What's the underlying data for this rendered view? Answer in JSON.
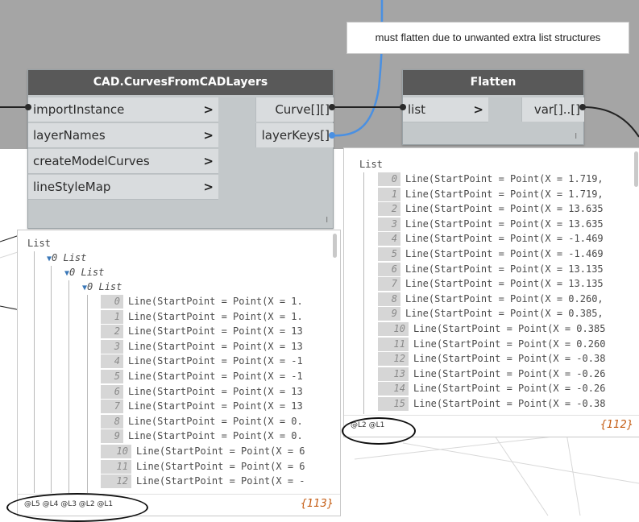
{
  "note": {
    "text": "must flatten due to unwanted extra list structures"
  },
  "node_cad": {
    "title": "CAD.CurvesFromCADLayers",
    "inputs": [
      "importInstance",
      "layerNames",
      "createModelCurves",
      "lineStyleMap"
    ],
    "outputs": [
      "Curve[][]",
      "layerKeys[]"
    ],
    "arrow": ">",
    "lacing_mark": "l"
  },
  "node_flatten": {
    "title": "Flatten",
    "inputs": [
      "list"
    ],
    "outputs": [
      "var[]..[]"
    ],
    "arrow": ">",
    "lacing_mark": "l"
  },
  "preview_left": {
    "root": "List",
    "nested": [
      "0 List",
      "0 List",
      "0 List"
    ],
    "items": [
      {
        "i": "0",
        "t": "Line(StartPoint = Point(X = 1."
      },
      {
        "i": "1",
        "t": "Line(StartPoint = Point(X = 1."
      },
      {
        "i": "2",
        "t": "Line(StartPoint = Point(X = 13"
      },
      {
        "i": "3",
        "t": "Line(StartPoint = Point(X = 13"
      },
      {
        "i": "4",
        "t": "Line(StartPoint = Point(X = -1"
      },
      {
        "i": "5",
        "t": "Line(StartPoint = Point(X = -1"
      },
      {
        "i": "6",
        "t": "Line(StartPoint = Point(X = 13"
      },
      {
        "i": "7",
        "t": "Line(StartPoint = Point(X = 13"
      },
      {
        "i": "8",
        "t": "Line(StartPoint = Point(X = 0."
      },
      {
        "i": "9",
        "t": "Line(StartPoint = Point(X = 0."
      },
      {
        "i": "10",
        "t": "Line(StartPoint = Point(X = 6"
      },
      {
        "i": "11",
        "t": "Line(StartPoint = Point(X = 6"
      },
      {
        "i": "12",
        "t": "Line(StartPoint = Point(X = -"
      }
    ],
    "levels": "@L5 @L4 @L3 @L2 @L1",
    "count": "{113}"
  },
  "preview_right": {
    "root": "List",
    "items": [
      {
        "i": "0",
        "t": "Line(StartPoint = Point(X = 1.719,"
      },
      {
        "i": "1",
        "t": "Line(StartPoint = Point(X = 1.719,"
      },
      {
        "i": "2",
        "t": "Line(StartPoint = Point(X = 13.635"
      },
      {
        "i": "3",
        "t": "Line(StartPoint = Point(X = 13.635"
      },
      {
        "i": "4",
        "t": "Line(StartPoint = Point(X = -1.469"
      },
      {
        "i": "5",
        "t": "Line(StartPoint = Point(X = -1.469"
      },
      {
        "i": "6",
        "t": "Line(StartPoint = Point(X = 13.135"
      },
      {
        "i": "7",
        "t": "Line(StartPoint = Point(X = 13.135"
      },
      {
        "i": "8",
        "t": "Line(StartPoint = Point(X = 0.260,"
      },
      {
        "i": "9",
        "t": "Line(StartPoint = Point(X = 0.385,"
      },
      {
        "i": "10",
        "t": "Line(StartPoint = Point(X = 0.385"
      },
      {
        "i": "11",
        "t": "Line(StartPoint = Point(X = 0.260"
      },
      {
        "i": "12",
        "t": "Line(StartPoint = Point(X = -0.38"
      },
      {
        "i": "13",
        "t": "Line(StartPoint = Point(X = -0.26"
      },
      {
        "i": "14",
        "t": "Line(StartPoint = Point(X = -0.26"
      },
      {
        "i": "15",
        "t": "Line(StartPoint = Point(X = -0.38"
      }
    ],
    "levels": "@L2 @L1",
    "count": "{112}"
  }
}
